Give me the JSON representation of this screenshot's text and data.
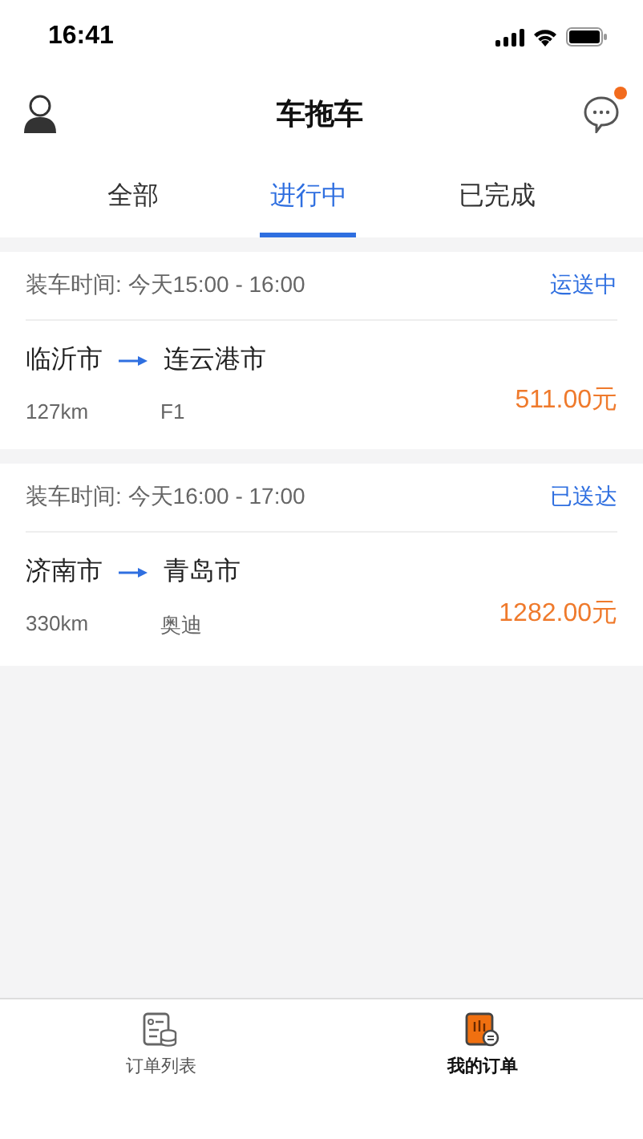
{
  "status_bar": {
    "time": "16:41"
  },
  "header": {
    "title": "车拖车",
    "messages": {
      "unread": true
    }
  },
  "tabs": [
    {
      "label": "全部",
      "selected": false
    },
    {
      "label": "进行中",
      "selected": true
    },
    {
      "label": "已完成",
      "selected": false
    }
  ],
  "orders": [
    {
      "load_time": "装车时间: 今天15:00 - 16:00",
      "status": "运送中",
      "from": "临沂市",
      "to": "连云港市",
      "distance": "127km",
      "vehicle": "F1",
      "price": "511.00元"
    },
    {
      "load_time": "装车时间: 今天16:00 - 17:00",
      "status": "已送达",
      "from": "济南市",
      "to": "青岛市",
      "distance": "330km",
      "vehicle": "奥迪",
      "price": "1282.00元"
    }
  ],
  "bottom_tabs": [
    {
      "label": "订单列表",
      "kind": "list",
      "selected": false
    },
    {
      "label": "我的订单",
      "kind": "mine",
      "selected": true
    }
  ]
}
